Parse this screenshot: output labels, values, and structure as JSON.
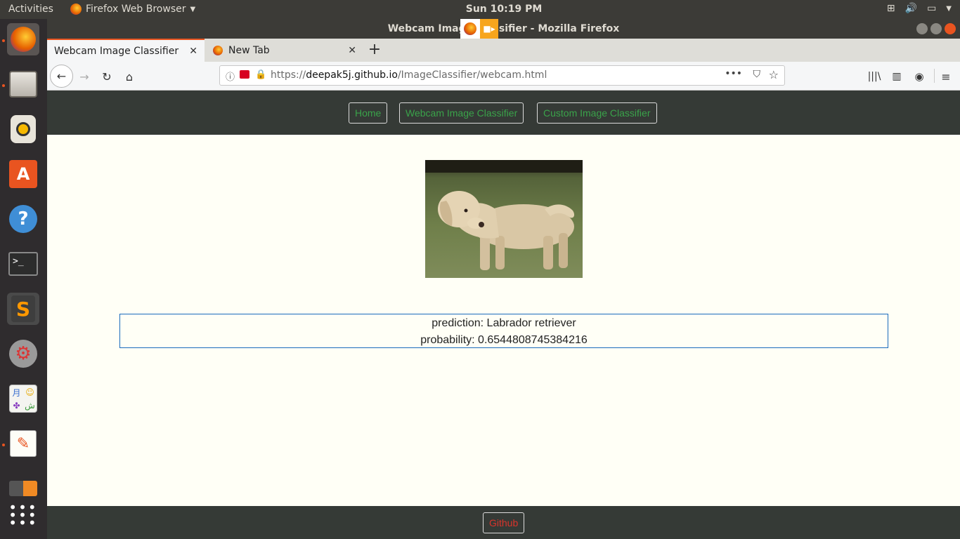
{
  "topbar": {
    "activities": "Activities",
    "app_name": "Firefox Web Browser",
    "clock": "Sun 10:19 PM"
  },
  "window": {
    "title": "Webcam Image Classifier - Mozilla Firefox"
  },
  "tabs": [
    {
      "label": "Webcam Image Classifier",
      "active": true
    },
    {
      "label": "New Tab",
      "active": false
    }
  ],
  "urlbar": {
    "scheme": "https://",
    "domain": "deepak5j.github.io",
    "path": "/ImageClassifier/webcam.html"
  },
  "site": {
    "nav": [
      "Home",
      "Webcam Image Classifier",
      "Custom Image Classifier"
    ],
    "prediction": "prediction: Labrador retriever",
    "probability": "probability: 0.6544808745384216",
    "footer_link": "Github"
  },
  "colors": {
    "accent": "#e95420",
    "nav_link": "#3aa34a",
    "footer_link": "#d9342b",
    "result_border": "#1a6bbd"
  }
}
